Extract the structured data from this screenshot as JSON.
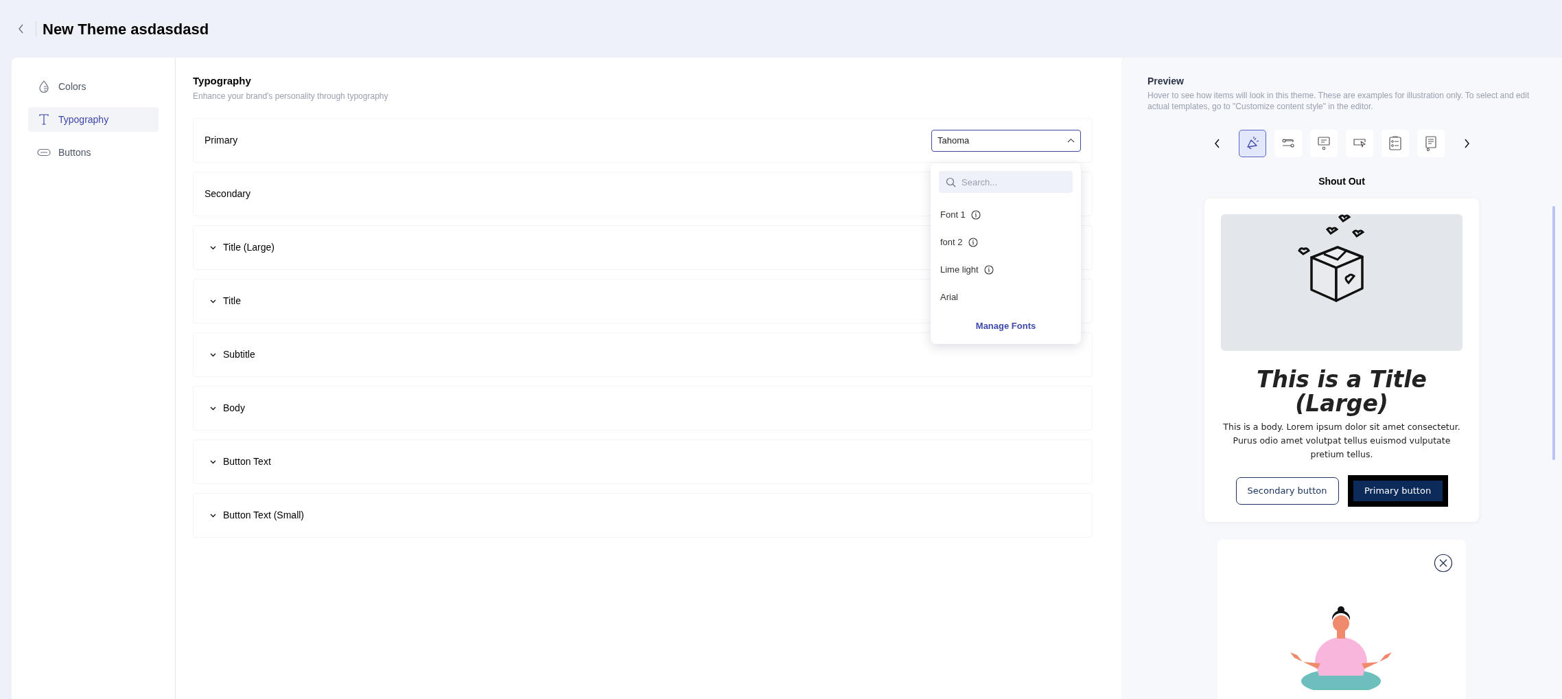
{
  "header": {
    "title": "New Theme asdasdasd"
  },
  "sidebar": {
    "items": [
      {
        "label": "Colors",
        "selected": false
      },
      {
        "label": "Typography",
        "selected": true
      },
      {
        "label": "Buttons",
        "selected": false
      }
    ]
  },
  "typography": {
    "title": "Typography",
    "subtitle": "Enhance your brand's personality through typography",
    "rows": [
      {
        "label": "Primary",
        "kind": "select"
      },
      {
        "label": "Secondary",
        "kind": "plain"
      },
      {
        "label": "Title (Large)",
        "kind": "collapsible"
      },
      {
        "label": "Title",
        "kind": "collapsible"
      },
      {
        "label": "Subtitle",
        "kind": "collapsible"
      },
      {
        "label": "Body",
        "kind": "collapsible"
      },
      {
        "label": "Button Text",
        "kind": "collapsible"
      },
      {
        "label": "Button Text (Small)",
        "kind": "collapsible"
      }
    ],
    "font_select": {
      "value": "Tahoma",
      "expanded": true,
      "search": {
        "placeholder": "Search..."
      },
      "options": [
        {
          "label": "Font 1",
          "info": true
        },
        {
          "label": "font 2",
          "info": true
        },
        {
          "label": "Lime light",
          "info": true
        },
        {
          "label": "Arial",
          "info": false
        }
      ],
      "action": "Manage Fonts"
    }
  },
  "preview": {
    "title": "Preview",
    "description": "Hover to see how items will look in this theme. These are examples for illustration only. To select and edit actual templates, go to \"Customize content style\" in the editor.",
    "templates": [
      {
        "selected": true
      },
      {
        "selected": false
      },
      {
        "selected": false
      },
      {
        "selected": false
      },
      {
        "selected": false
      },
      {
        "selected": false
      }
    ],
    "template_name": "Shout Out",
    "card": {
      "title": "This is a Title (Large)",
      "body": "This is a body. Lorem ipsum dolor sit amet consectetur. Purus odio amet volutpat tellus euismod vulputate pretium tellus.",
      "buttons": [
        {
          "label": "Secondary button",
          "kind": "secondary"
        },
        {
          "label": "Primary button",
          "kind": "primary"
        }
      ]
    }
  }
}
